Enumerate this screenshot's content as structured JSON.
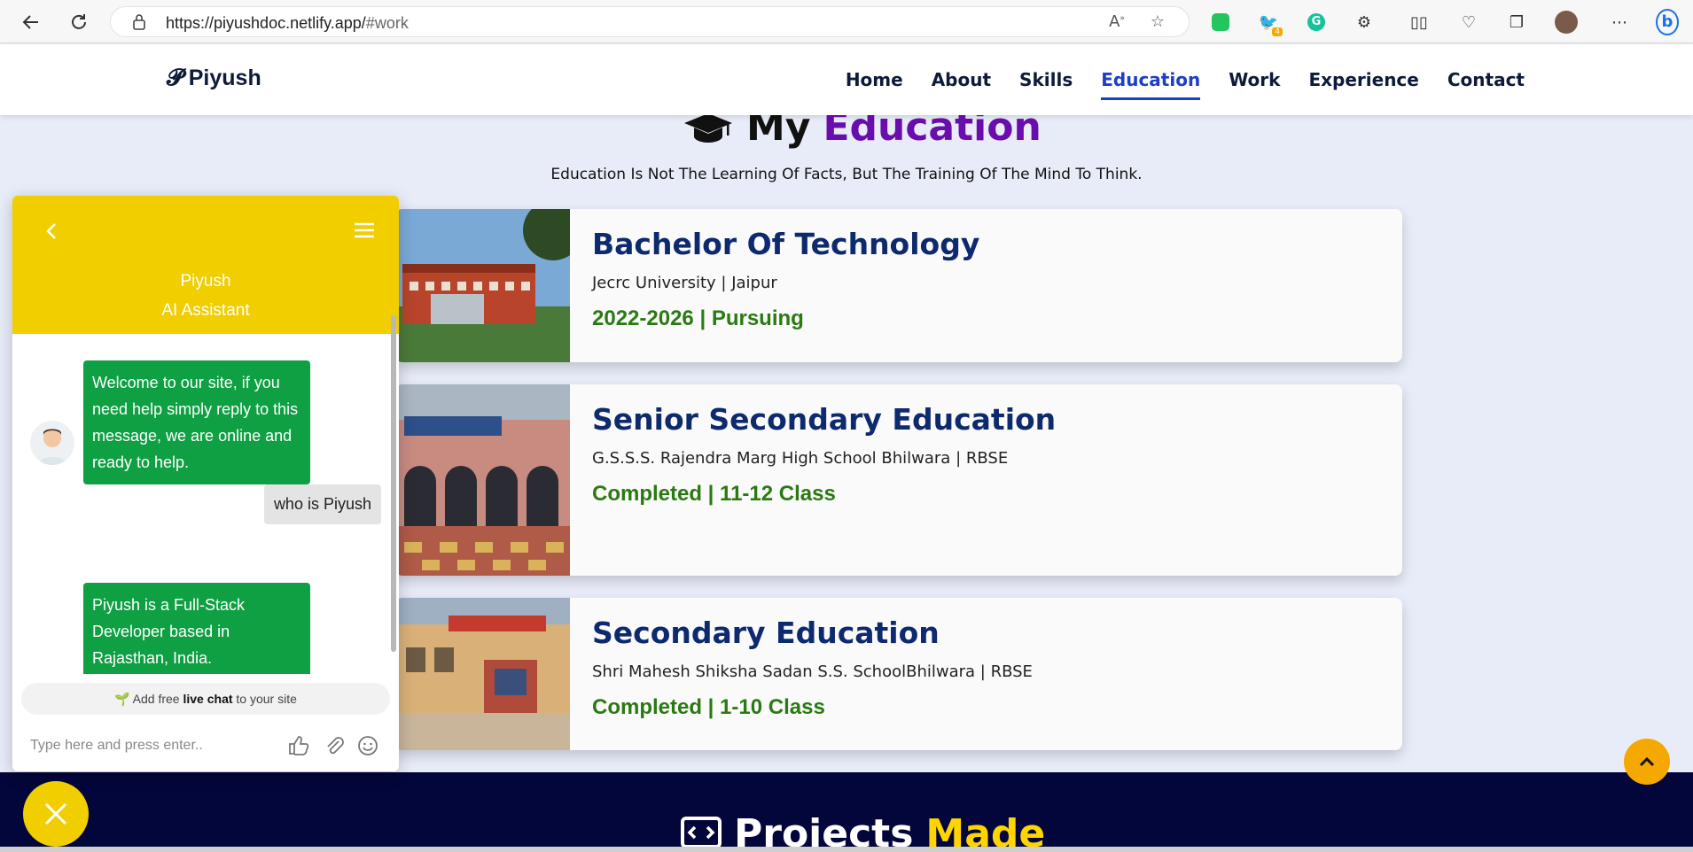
{
  "browser": {
    "url_host": "https://piyushdoc.netlify.app/",
    "url_hash": "#work",
    "ext_badge": "4"
  },
  "header": {
    "logo": "Piyush",
    "nav": [
      "Home",
      "About",
      "Skills",
      "Education",
      "Work",
      "Experience",
      "Contact"
    ],
    "active": "Education"
  },
  "education": {
    "title_plain": "My",
    "title_accent": "Education",
    "quote": "Education Is Not The Learning Of Facts, But The Training Of The Mind To Think.",
    "items": [
      {
        "degree": "Bachelor Of Technology",
        "school": "Jecrc University | Jaipur",
        "period": "2022-2026 | Pursuing"
      },
      {
        "degree": "Senior Secondary Education",
        "school": "G.S.S.S. Rajendra Marg High School Bhilwara | RBSE",
        "period": "Completed | 11-12 Class"
      },
      {
        "degree": "Secondary Education",
        "school": "Shri Mahesh Shiksha Sadan S.S. SchoolBhilwara | RBSE",
        "period": "Completed | 1-10 Class"
      }
    ]
  },
  "projects": {
    "title_plain": "Projects",
    "title_accent": "Made"
  },
  "chat": {
    "name_line1": "Piyush",
    "name_line2": "AI Assistant",
    "messages": [
      {
        "from": "bot",
        "text": "Welcome to our site, if you need help simply reply to this message, we are online and ready to help."
      },
      {
        "from": "user",
        "text": "who is Piyush"
      },
      {
        "from": "bot",
        "text": "Piyush is a Full-Stack Developer based in Rajasthan, India."
      }
    ],
    "promo_prefix": "Add free ",
    "promo_bold": "live chat",
    "promo_suffix": " to your site",
    "input_placeholder": "Type here and press enter.."
  },
  "colors": {
    "accent_purple": "#6a0dad",
    "nav_active": "#1d3ec8",
    "chat_yellow": "#f0ce00",
    "bot_green": "#0ea043",
    "period_green": "#2a7a12",
    "footer_navy": "#03063a"
  }
}
